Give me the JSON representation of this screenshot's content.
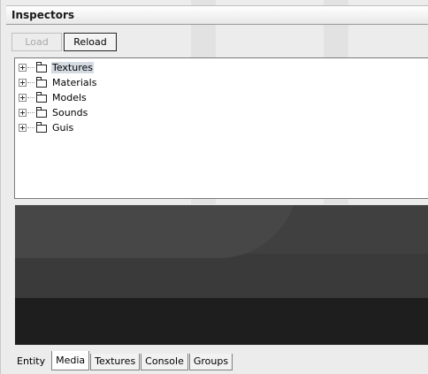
{
  "window": {
    "title": "Inspectors"
  },
  "toolbar": {
    "load_label": "Load",
    "reload_label": "Reload"
  },
  "tree": {
    "items": [
      {
        "label": "Textures",
        "selected": true
      },
      {
        "label": "Materials",
        "selected": false
      },
      {
        "label": "Models",
        "selected": false
      },
      {
        "label": "Sounds",
        "selected": false
      },
      {
        "label": "Guis",
        "selected": false
      }
    ]
  },
  "tabs": [
    {
      "label": "Entity",
      "active": false
    },
    {
      "label": "Media",
      "active": true
    },
    {
      "label": "Textures",
      "active": false
    },
    {
      "label": "Console",
      "active": false
    },
    {
      "label": "Groups",
      "active": false
    }
  ],
  "icons": {
    "expander": "plus-box-icon",
    "folder": "folder-icon"
  },
  "colors": {
    "selection": "#d4dbe3",
    "preview_top": "#3a3a3a",
    "preview_bottom": "#1e1e1e"
  }
}
